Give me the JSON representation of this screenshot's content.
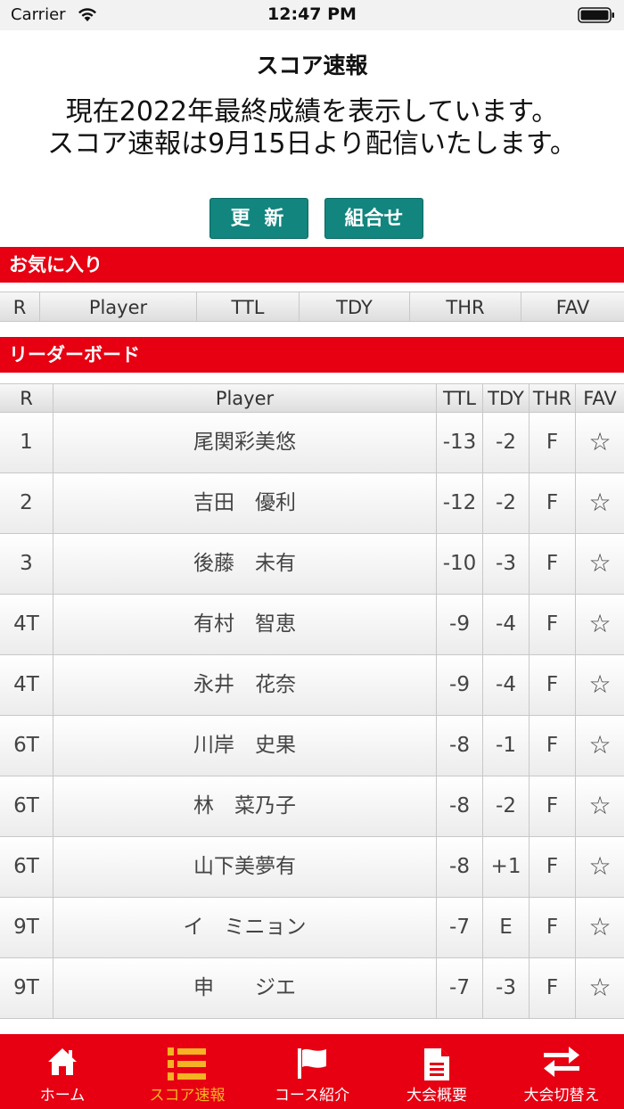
{
  "status": {
    "carrier": "Carrier",
    "time": "12:47 PM"
  },
  "header": {
    "title": "スコア速報",
    "notice_line1": "現在2022年最終成績を表示しています。",
    "notice_line2": "スコア速報は9月15日より配信いたします。"
  },
  "buttons": {
    "refresh": "更 新",
    "pairings": "組合せ"
  },
  "favorites": {
    "title": "お気に入り",
    "columns": [
      "R",
      "Player",
      "TTL",
      "TDY",
      "THR",
      "FAV"
    ]
  },
  "leaderboard": {
    "title": "リーダーボード",
    "columns": [
      "R",
      "Player",
      "TTL",
      "TDY",
      "THR",
      "FAV"
    ],
    "rows": [
      {
        "rank": "1",
        "player": "尾関彩美悠",
        "ttl": "-13",
        "tdy": "-2",
        "thr": "F",
        "fav": "☆"
      },
      {
        "rank": "2",
        "player": "吉田　優利",
        "ttl": "-12",
        "tdy": "-2",
        "thr": "F",
        "fav": "☆"
      },
      {
        "rank": "3",
        "player": "後藤　未有",
        "ttl": "-10",
        "tdy": "-3",
        "thr": "F",
        "fav": "☆"
      },
      {
        "rank": "4T",
        "player": "有村　智恵",
        "ttl": "-9",
        "tdy": "-4",
        "thr": "F",
        "fav": "☆"
      },
      {
        "rank": "4T",
        "player": "永井　花奈",
        "ttl": "-9",
        "tdy": "-4",
        "thr": "F",
        "fav": "☆"
      },
      {
        "rank": "6T",
        "player": "川岸　史果",
        "ttl": "-8",
        "tdy": "-1",
        "thr": "F",
        "fav": "☆"
      },
      {
        "rank": "6T",
        "player": "林　菜乃子",
        "ttl": "-8",
        "tdy": "-2",
        "thr": "F",
        "fav": "☆"
      },
      {
        "rank": "6T",
        "player": "山下美夢有",
        "ttl": "-8",
        "tdy": "+1",
        "thr": "F",
        "fav": "☆"
      },
      {
        "rank": "9T",
        "player": "イ　ミニョン",
        "ttl": "-7",
        "tdy": "E",
        "thr": "F",
        "fav": "☆"
      },
      {
        "rank": "9T",
        "player": "申　　ジエ",
        "ttl": "-7",
        "tdy": "-3",
        "thr": "F",
        "fav": "☆"
      }
    ]
  },
  "tabs": [
    {
      "label": "ホーム",
      "icon": "home-icon"
    },
    {
      "label": "スコア速報",
      "icon": "ranking-list-icon",
      "active": true
    },
    {
      "label": "コース紹介",
      "icon": "flag-icon"
    },
    {
      "label": "大会概要",
      "icon": "document-icon"
    },
    {
      "label": "大会切替え",
      "icon": "swap-arrows-icon"
    }
  ],
  "colors": {
    "brand_red": "#e60012",
    "button_teal": "#12857e",
    "active_tab": "#f5b324"
  }
}
